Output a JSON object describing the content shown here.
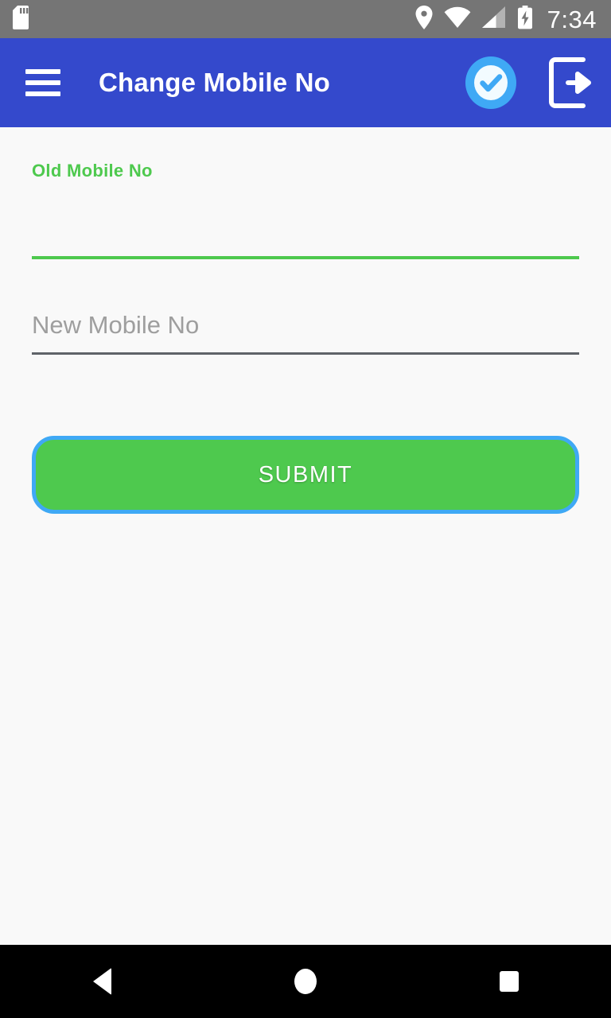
{
  "status_bar": {
    "background": "#757575",
    "time": "7:34",
    "icons": [
      {
        "name": "sd-card-icon",
        "position": "left"
      },
      {
        "name": "location-pin-icon",
        "position": "right"
      },
      {
        "name": "wifi-icon",
        "position": "right"
      },
      {
        "name": "cell-signal-icon",
        "position": "right"
      },
      {
        "name": "battery-charging-icon",
        "position": "right"
      }
    ]
  },
  "app_bar": {
    "background": "#3449cc",
    "title": "Change Mobile No",
    "menu_icon": "hamburger-menu-icon",
    "actions": [
      {
        "name": "verified-check-icon",
        "color": "#3fa9f5"
      },
      {
        "name": "logout-icon",
        "color": "#ffffff"
      }
    ]
  },
  "form": {
    "old_mobile": {
      "label": "Old Mobile No",
      "value": "",
      "placeholder": "",
      "label_color": "#4ec94e",
      "underline_color": "#4ec94e"
    },
    "new_mobile": {
      "label": "New Mobile No",
      "value": "",
      "placeholder": "New Mobile No",
      "placeholder_color": "#9e9e9e",
      "underline_color": "#5f6368"
    },
    "submit_label": "SUBMIT",
    "submit_fill": "#4ec94e",
    "submit_border": "#3fa9f5"
  },
  "nav_bar": {
    "background": "#000000",
    "buttons": [
      {
        "name": "nav-back-button",
        "glyph": "back-triangle-icon"
      },
      {
        "name": "nav-home-button",
        "glyph": "home-circle-icon"
      },
      {
        "name": "nav-recents-button",
        "glyph": "recents-square-icon"
      }
    ]
  }
}
